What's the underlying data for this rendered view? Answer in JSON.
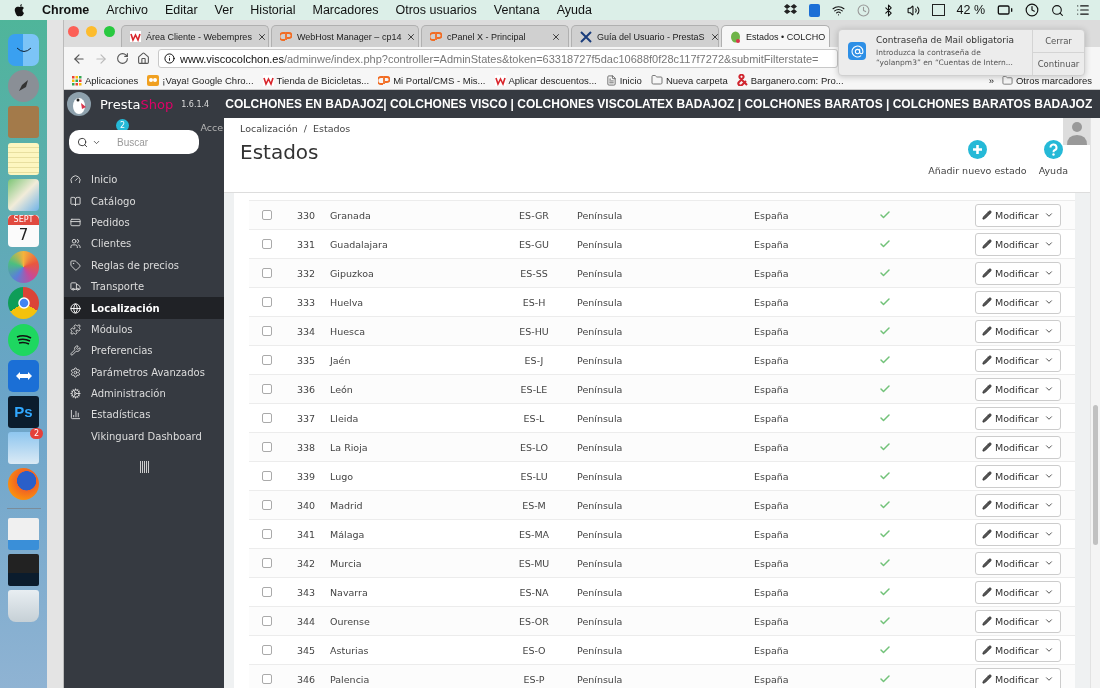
{
  "menu_bar": {
    "app": "Chrome",
    "menus": [
      "Archivo",
      "Editar",
      "Ver",
      "Historial",
      "Marcadores",
      "Otros usuarios",
      "Ventana",
      "Ayuda"
    ],
    "battery": "42 %"
  },
  "dock": {
    "calendar_month": "SEPT",
    "calendar_day": "7",
    "photoshop_label": "Ps",
    "mail_badge": "2"
  },
  "tabs": [
    {
      "label": "Área Cliente - Webempres",
      "kind": "webempresa",
      "closable": true,
      "selected": false
    },
    {
      "label": "WebHost Manager – cp14",
      "kind": "cpanel",
      "closable": true,
      "selected": false
    },
    {
      "label": "cPanel X - Principal",
      "kind": "cpanel",
      "closable": true,
      "selected": false
    },
    {
      "label": "Guía del Usuario - PrestaS",
      "kind": "guide",
      "closable": true,
      "selected": false
    },
    {
      "label": "Estados • COLCHO",
      "kind": "prestashop",
      "closable": false,
      "selected": true
    }
  ],
  "address": {
    "host": "www.viscocolchon.es",
    "path": "/adminwe/index.php?controller=AdminStates&token=63318727f5dac10688f0f28c117f7272&submitFilterstate="
  },
  "bookmarks": [
    {
      "label": "Aplicaciones",
      "kind": "apps"
    },
    {
      "label": "¡Vaya! Google Chro...",
      "kind": "owl"
    },
    {
      "label": "Tienda de Bicicletas...",
      "kind": "webempresa"
    },
    {
      "label": "Mi Portal/CMS - Mis...",
      "kind": "cpanel"
    },
    {
      "label": "Aplicar descuentos...",
      "kind": "webempresa"
    },
    {
      "label": "Inicio",
      "kind": "page"
    },
    {
      "label": "Nueva carpeta",
      "kind": "folder"
    },
    {
      "label": "Barganero.com: Pro...",
      "kind": "amp"
    }
  ],
  "bookmarks_more": {
    "chevron": "»",
    "label": "Otros marcadores"
  },
  "notification": {
    "title": "Contraseña de Mail obligatoria",
    "line_1": "Introduzca la contraseña de",
    "line_2": "“yolanpm3” en “Cuentas de Intern...",
    "buttons": [
      "Cerrar",
      "Continuar"
    ]
  },
  "header": {
    "brand": "PrestaShop",
    "version": "1.6.1.4",
    "shop_title": "COLCHONES EN BADAJOZ| COLCHONES VISCO | COLCHONES VISCOLATEX BADAJOZ | COLCHONES BARATOS | COLCHONES BARATOS BADAJOZ"
  },
  "sidebar": {
    "quick_access_badge": "2",
    "quick_access_label": "Acce",
    "search": {
      "placeholder": "Buscar"
    },
    "items": [
      {
        "label": "Inicio",
        "kind": "dashboard",
        "selected": false
      },
      {
        "label": "Catálogo",
        "kind": "book",
        "selected": false
      },
      {
        "label": "Pedidos",
        "kind": "card",
        "selected": false
      },
      {
        "label": "Clientes",
        "kind": "users",
        "selected": false
      },
      {
        "label": "Reglas de precios",
        "kind": "tag",
        "selected": false
      },
      {
        "label": "Transporte",
        "kind": "truck",
        "selected": false
      },
      {
        "label": "Localización",
        "kind": "globe",
        "selected": true
      },
      {
        "label": "Módulos",
        "kind": "puzzle",
        "selected": false
      },
      {
        "label": "Preferencias",
        "kind": "wrench",
        "selected": false
      },
      {
        "label": "Parámetros Avanzados",
        "kind": "cogs",
        "selected": false
      },
      {
        "label": "Administración",
        "kind": "cog",
        "selected": false
      },
      {
        "label": "Estadísticas",
        "kind": "chart",
        "selected": false
      },
      {
        "label": "Vikinguard Dashboard",
        "kind": "none",
        "selected": false
      }
    ]
  },
  "breadcrumb": [
    "Localización",
    "/",
    "Estados"
  ],
  "page_title": "Estados",
  "toolbar": [
    {
      "label": "Añadir nuevo estado",
      "kind": "add"
    },
    {
      "label": "Ayuda",
      "kind": "help"
    }
  ],
  "rows": [
    {
      "id": "330",
      "name": "Granada",
      "iso": "ES-GR",
      "zone": "Península",
      "country": "España",
      "active": true,
      "checked": false,
      "action": "Modificar"
    },
    {
      "id": "331",
      "name": "Guadalajara",
      "iso": "ES-GU",
      "zone": "Península",
      "country": "España",
      "active": true,
      "checked": false,
      "action": "Modificar"
    },
    {
      "id": "332",
      "name": "Gipuzkoa",
      "iso": "ES-SS",
      "zone": "Península",
      "country": "España",
      "active": true,
      "checked": false,
      "action": "Modificar"
    },
    {
      "id": "333",
      "name": "Huelva",
      "iso": "ES-H",
      "zone": "Península",
      "country": "España",
      "active": true,
      "checked": false,
      "action": "Modificar"
    },
    {
      "id": "334",
      "name": "Huesca",
      "iso": "ES-HU",
      "zone": "Península",
      "country": "España",
      "active": true,
      "checked": false,
      "action": "Modificar"
    },
    {
      "id": "335",
      "name": "Jaén",
      "iso": "ES-J",
      "zone": "Península",
      "country": "España",
      "active": true,
      "checked": false,
      "action": "Modificar"
    },
    {
      "id": "336",
      "name": "León",
      "iso": "ES-LE",
      "zone": "Península",
      "country": "España",
      "active": true,
      "checked": false,
      "action": "Modificar"
    },
    {
      "id": "337",
      "name": "Lleida",
      "iso": "ES-L",
      "zone": "Península",
      "country": "España",
      "active": true,
      "checked": false,
      "action": "Modificar"
    },
    {
      "id": "338",
      "name": "La Rioja",
      "iso": "ES-LO",
      "zone": "Península",
      "country": "España",
      "active": true,
      "checked": false,
      "action": "Modificar"
    },
    {
      "id": "339",
      "name": "Lugo",
      "iso": "ES-LU",
      "zone": "Península",
      "country": "España",
      "active": true,
      "checked": false,
      "action": "Modificar"
    },
    {
      "id": "340",
      "name": "Madrid",
      "iso": "ES-M",
      "zone": "Península",
      "country": "España",
      "active": true,
      "checked": false,
      "action": "Modificar"
    },
    {
      "id": "341",
      "name": "Málaga",
      "iso": "ES-MA",
      "zone": "Península",
      "country": "España",
      "active": true,
      "checked": false,
      "action": "Modificar"
    },
    {
      "id": "342",
      "name": "Murcia",
      "iso": "ES-MU",
      "zone": "Península",
      "country": "España",
      "active": true,
      "checked": false,
      "action": "Modificar"
    },
    {
      "id": "343",
      "name": "Navarra",
      "iso": "ES-NA",
      "zone": "Península",
      "country": "España",
      "active": true,
      "checked": false,
      "action": "Modificar"
    },
    {
      "id": "344",
      "name": "Ourense",
      "iso": "ES-OR",
      "zone": "Península",
      "country": "España",
      "active": true,
      "checked": false,
      "action": "Modificar"
    },
    {
      "id": "345",
      "name": "Asturias",
      "iso": "ES-O",
      "zone": "Península",
      "country": "España",
      "active": true,
      "checked": false,
      "action": "Modificar"
    },
    {
      "id": "346",
      "name": "Palencia",
      "iso": "ES-P",
      "zone": "Península",
      "country": "España",
      "active": true,
      "checked": false,
      "action": "Modificar"
    }
  ]
}
